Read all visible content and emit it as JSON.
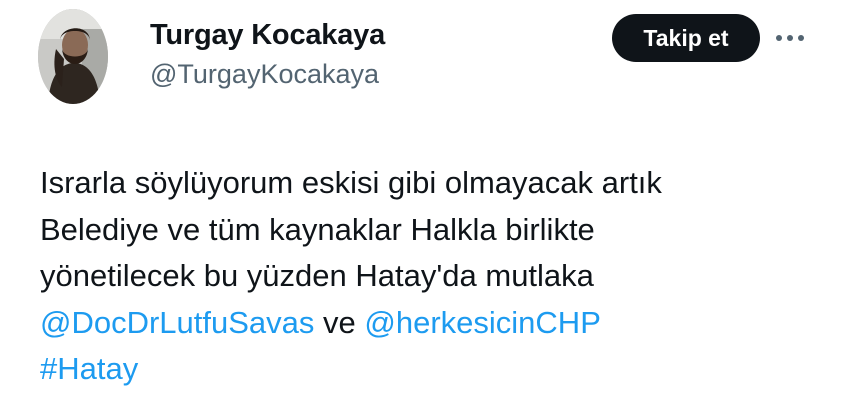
{
  "author": {
    "display_name": "Turgay Kocakaya",
    "handle": "@TurgayKocakaya",
    "avatar_icon": "profile-photo"
  },
  "actions": {
    "follow_label": "Takip et",
    "more_icon": "more-dots-icon"
  },
  "tweet": {
    "line1": "Israrla söylüyorum eskisi gibi olmayacak artık",
    "line2": "Belediye ve tüm kaynaklar Halkla birlikte",
    "line3": "yönetilecek bu yüzden Hatay'da mutlaka",
    "mention1": "@DocDrLutfuSavas",
    "connector": " ve ",
    "mention2": "@herkesicinCHP",
    "hashtag": "#Hatay"
  },
  "colors": {
    "text": "#0f1419",
    "secondary": "#536471",
    "link": "#1d9bf0",
    "button_bg": "#0f1419"
  }
}
